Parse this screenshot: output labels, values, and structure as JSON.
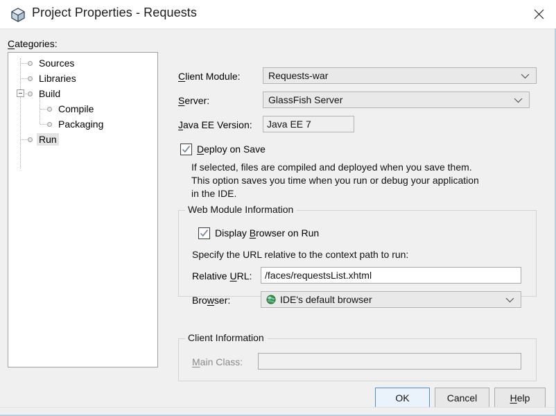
{
  "window": {
    "title": "Project Properties - Requests",
    "icon": "project-cube-icon",
    "close_label": "✕"
  },
  "categories": {
    "label": "Categories:",
    "label_mnemonic": "C",
    "items": [
      {
        "label": "Sources",
        "level": 1,
        "selected": false,
        "expandable": false
      },
      {
        "label": "Libraries",
        "level": 1,
        "selected": false,
        "expandable": false
      },
      {
        "label": "Build",
        "level": 1,
        "selected": false,
        "expandable": true,
        "expanded": true
      },
      {
        "label": "Compile",
        "level": 2,
        "selected": false,
        "expandable": false
      },
      {
        "label": "Packaging",
        "level": 2,
        "selected": false,
        "expandable": false
      },
      {
        "label": "Run",
        "level": 1,
        "selected": true,
        "expandable": false
      }
    ]
  },
  "form": {
    "client_module": {
      "label_pre": "",
      "label_mnemonic": "C",
      "label_post": "lient Module:",
      "value": "Requests-war",
      "control": "combobox"
    },
    "server": {
      "label_pre": "",
      "label_mnemonic": "S",
      "label_post": "erver:",
      "value": "GlassFish Server",
      "control": "combobox"
    },
    "java_ee_version": {
      "label_pre": "",
      "label_mnemonic": "J",
      "label_post": "ava EE Version:",
      "value": "Java EE 7",
      "control": "textfield-readonly"
    },
    "deploy_on_save": {
      "label_pre": "",
      "label_mnemonic": "D",
      "label_post": "eploy on Save",
      "checked": true,
      "description": "If selected, files are compiled and deployed when you save them.\nThis option saves you time when you run or debug your application\nin the IDE."
    }
  },
  "web_module_group": {
    "title": "Web Module Information",
    "display_browser_on_run": {
      "label_pre": "Display ",
      "label_mnemonic": "B",
      "label_post": "rowser on Run",
      "checked": true
    },
    "url_hint": "Specify the URL relative to the context path to run:",
    "relative_url": {
      "label_pre": "Relative ",
      "label_mnemonic": "U",
      "label_post": "RL:",
      "value": "/faces/requestsList.xhtml"
    },
    "browser": {
      "label_pre": "Bro",
      "label_mnemonic": "w",
      "label_post": "ser:",
      "value": "IDE's default browser",
      "icon": "globe-icon"
    }
  },
  "client_info_group": {
    "title": "Client Information",
    "main_class": {
      "label_pre": "",
      "label_mnemonic": "M",
      "label_post": "ain Class:",
      "value": "",
      "disabled": true
    }
  },
  "footer": {
    "ok": "OK",
    "cancel": "Cancel",
    "help_pre": "",
    "help_mnemonic": "H",
    "help_post": "elp"
  },
  "colors": {
    "dialog_bg": "#f0f0f0",
    "titlebar_bg": "#ffffff",
    "field_bg": "#ffffff",
    "combo_bg": "#e9e9e9",
    "default_button_border": "#4f8ecb",
    "selection_bg": "#e4e4e4"
  }
}
